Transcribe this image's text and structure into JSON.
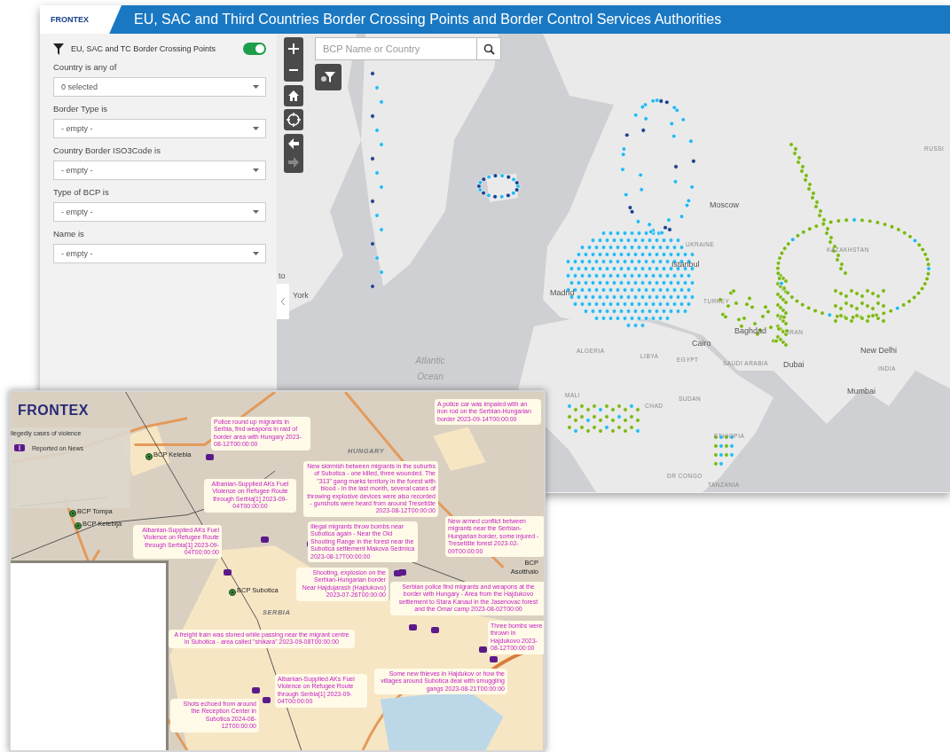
{
  "top_window": {
    "logo": "FRONTEX",
    "title": "EU, SAC and Third Countries Border Crossing Points and Border Control Services Authorities",
    "filter_panel": {
      "layer_title": "EU, SAC and TC Border Crossing Points",
      "layer_on": true,
      "filters": [
        {
          "label": "Country is any of",
          "value": "0 selected"
        },
        {
          "label": "Border Type is",
          "value": "- empty -"
        },
        {
          "label": "Country Border ISO3Code is",
          "value": "- empty -"
        },
        {
          "label": "Type of BCP is",
          "value": "- empty -"
        },
        {
          "label": "Name is",
          "value": "- empty -"
        }
      ]
    },
    "map": {
      "search": {
        "placeholder": "BCP Name or Country"
      },
      "labels": [
        {
          "text": "to",
          "kind": "city"
        },
        {
          "text": "York",
          "kind": "city"
        },
        {
          "text": "Moscow",
          "kind": "city"
        },
        {
          "text": "UKRAINE",
          "kind": "country"
        },
        {
          "text": "KAZAKHSTAN",
          "kind": "country"
        },
        {
          "text": "RUSSI",
          "kind": "country"
        },
        {
          "text": "TURKEY",
          "kind": "country"
        },
        {
          "text": "Madrid",
          "kind": "city"
        },
        {
          "text": "Istanbul",
          "kind": "city"
        },
        {
          "text": "Cairo",
          "kind": "city"
        },
        {
          "text": "Baghdad",
          "kind": "city"
        },
        {
          "text": "IRAN",
          "kind": "country"
        },
        {
          "text": "New Delhi",
          "kind": "city"
        },
        {
          "text": "SAUDI ARABIA",
          "kind": "country"
        },
        {
          "text": "Dubai",
          "kind": "city"
        },
        {
          "text": "EGYPT",
          "kind": "country"
        },
        {
          "text": "LIBYA",
          "kind": "country"
        },
        {
          "text": "ALGERIA",
          "kind": "country"
        },
        {
          "text": "INDIA",
          "kind": "country"
        },
        {
          "text": "Mumbai",
          "kind": "city"
        },
        {
          "text": "MALI",
          "kind": "country"
        },
        {
          "text": "CHAD",
          "kind": "country"
        },
        {
          "text": "SUDAN",
          "kind": "country"
        },
        {
          "text": "ETHIOPIA",
          "kind": "country"
        },
        {
          "text": "DR CONGO",
          "kind": "country"
        },
        {
          "text": "TANZANIA",
          "kind": "country"
        },
        {
          "text": "Atlantic Ocean",
          "kind": "ocean"
        }
      ]
    }
  },
  "bottom_window": {
    "logo": "FRONTEX",
    "legend": {
      "title": "llegedly cases of violence",
      "items": [
        "Reported on News"
      ]
    },
    "bcp_labels": [
      "BCP Kelebia",
      "BCP Tompa",
      "BCP Kelebija",
      "BCP Subotica",
      "BCP Asotthalo"
    ],
    "region_labels": [
      "HUNGARY",
      "SERBIA"
    ],
    "callouts": [
      "Police round up migrants in Serbia, find weapons in raid of border area with Hungary 2023-08-12T00:00:00",
      "A police car was impaled with an iron rod on the Serbian-Hungarian border 2023-09-14T00:00:00",
      "Albanian-Supplied AKs Fuel Violence on Refugee Route through Serbia[1] 2023-09-04T00:00:00",
      "New skirmish between migrants in the suburbs of Subotica - one killed, three wounded. The \"313\" gang marks territory in the forest with blood - In the last month, several cases of throwing explosive devices were also recorded - gunshots were heard from around Tresetište 2023-08-12T00:00:00",
      "Albanian-Supplied AKs Fuel Violence on Refugee Route through Serbia[1] 2023-09-04T00:00:00",
      "New armed conflict between migrants near the Serbian-Hungarian border, some injured - Tresetište forest 2023-02-09T00:00:00",
      "Illegal migrants throw bombs near Subotica again - Near the Old Shooting Range in the forest near the Subotica settlement Makova Sedmica 2023-08-17T00:00:00",
      "Serbian police find migrants and weapons at the border with Hungary - Area from the Hajdukovo settlement to Stara Kanaul in the Jasenovac forest and the Omar camp 2023-08-02T00:00",
      "Shooting, explosion on the Serbian-Hungarian border Near Hajdujarash (Hajdukovo) 2023-07-26T00:00:00",
      "A freight train was stoned while passing near the migrant centre in Subotica - area called \"shikara\" 2023-09-08T00:00:00",
      "Three bombs were thrown in Hajdukovo 2023-08-12T00:00:00",
      "Albanian-Supplied AKs Fuel Violence on Refugee Route through Serbia[1] 2023-09-04T00:00:00",
      "Some new thieves in Hajdukov or how the villages around Subotica deal with smuggling gangs 2023-08-21T00:00:00",
      "Shots echoed from around the Reception Center in Subotica 2024-08-12T00:00:00"
    ]
  }
}
